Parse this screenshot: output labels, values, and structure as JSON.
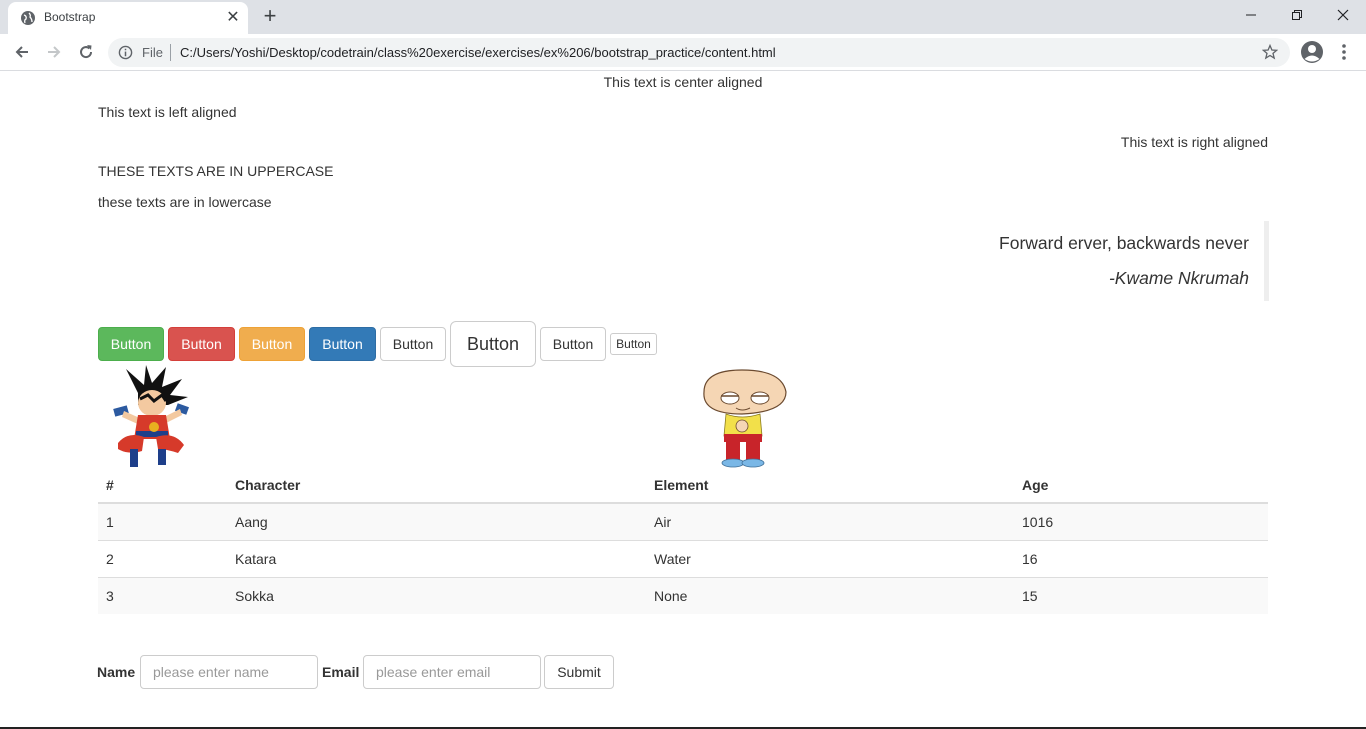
{
  "browser": {
    "tab_title": "Bootstrap",
    "url_scheme": "File",
    "url": "C:/Users/Yoshi/Desktop/codetrain/class%20exercise/exercises/ex%206/bootstrap_practice/content.html"
  },
  "text": {
    "center": "This text is center aligned",
    "left": "This text is left aligned",
    "right": "This text is right aligned",
    "upper": "THESE TEXTS ARE IN UPPERCASE",
    "lower": "these texts are in lowercase"
  },
  "quote": {
    "text": "Forward erver, backwards never",
    "author": "-Kwame Nkrumah"
  },
  "buttons": [
    {
      "label": "Button",
      "style": "success"
    },
    {
      "label": "Button",
      "style": "danger"
    },
    {
      "label": "Button",
      "style": "warning"
    },
    {
      "label": "Button",
      "style": "primary"
    },
    {
      "label": "Button",
      "style": "default"
    },
    {
      "label": "Button",
      "style": "default-large"
    },
    {
      "label": "Button",
      "style": "default"
    },
    {
      "label": "Button",
      "style": "default-small"
    }
  ],
  "table": {
    "headers": [
      "#",
      "Character",
      "Element",
      "Age"
    ],
    "rows": [
      [
        "1",
        "Aang",
        "Air",
        "1016"
      ],
      [
        "2",
        "Katara",
        "Water",
        "16"
      ],
      [
        "3",
        "Sokka",
        "None",
        "15"
      ]
    ]
  },
  "form": {
    "name_label": "Name",
    "name_placeholder": "please enter name",
    "email_label": "Email",
    "email_placeholder": "please enter email",
    "submit_label": "Submit"
  }
}
